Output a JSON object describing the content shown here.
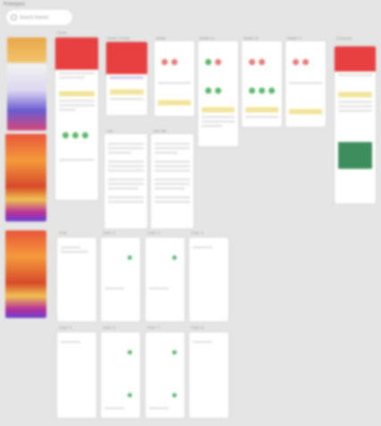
{
  "app": {
    "title": "Prototypes"
  },
  "search": {
    "placeholder": "Search frames"
  },
  "frames_row1": [
    {
      "label": "Home"
    },
    {
      "label": "Home / Promo"
    },
    {
      "label": "Detail"
    },
    {
      "label": "Detail / A"
    },
    {
      "label": "Detail / B"
    },
    {
      "label": "Detail / C"
    },
    {
      "label": "Checkout"
    }
  ],
  "frames_row2": [
    {
      "label": "List"
    },
    {
      "label": "List / Alt"
    }
  ],
  "frames_row3": [
    {
      "label": "Chat"
    },
    {
      "label": "Chat / 2"
    },
    {
      "label": "Chat / 3"
    },
    {
      "label": "Chat / 4"
    }
  ],
  "frames_row4": [
    {
      "label": "Chat / 5"
    },
    {
      "label": "Chat / 6"
    },
    {
      "label": "Chat / 7"
    },
    {
      "label": "Chat / 8"
    }
  ]
}
